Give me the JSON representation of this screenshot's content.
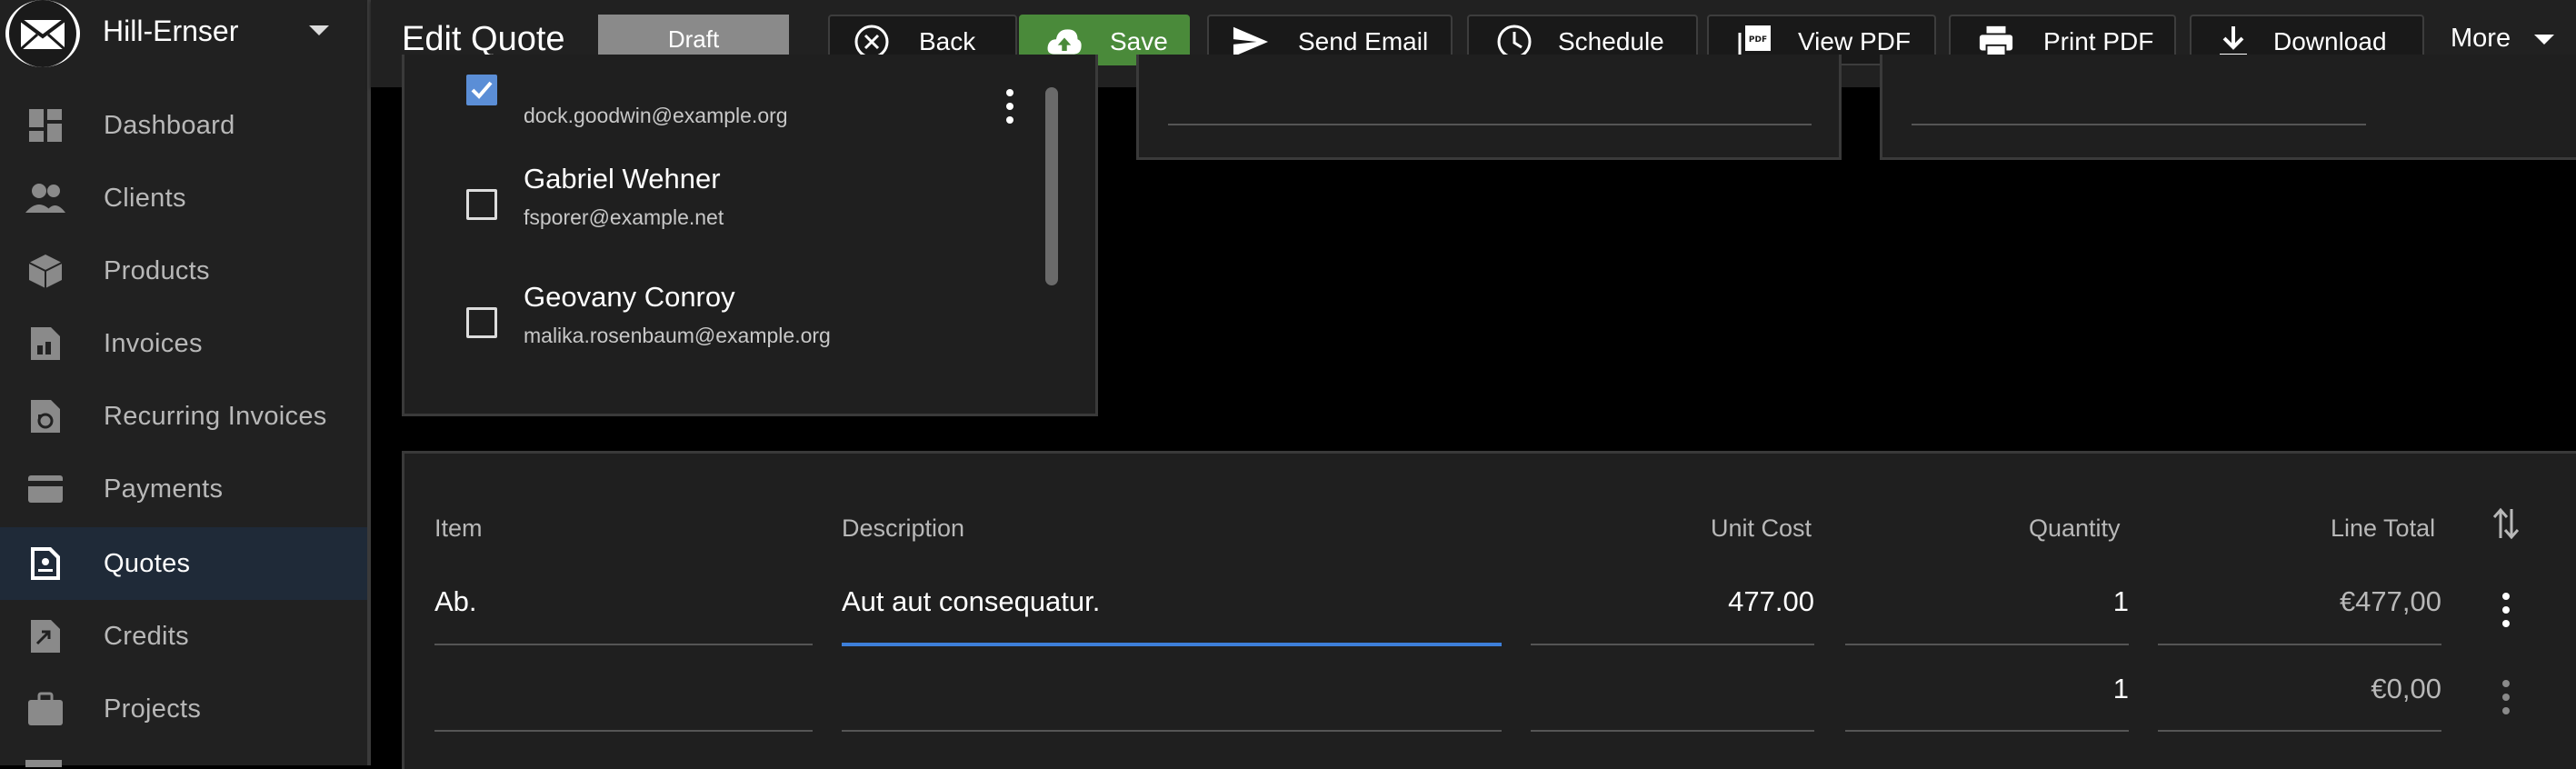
{
  "company": {
    "name": "Hill-Ernser"
  },
  "sidebar": {
    "items": [
      {
        "label": "Dashboard",
        "icon": "dashboard-icon"
      },
      {
        "label": "Clients",
        "icon": "clients-icon"
      },
      {
        "label": "Products",
        "icon": "products-icon"
      },
      {
        "label": "Invoices",
        "icon": "invoices-icon"
      },
      {
        "label": "Recurring Invoices",
        "icon": "recurring-invoices-icon"
      },
      {
        "label": "Payments",
        "icon": "payments-icon"
      },
      {
        "label": "Quotes",
        "icon": "quotes-icon",
        "active": true
      },
      {
        "label": "Credits",
        "icon": "credits-icon"
      },
      {
        "label": "Projects",
        "icon": "projects-icon"
      }
    ]
  },
  "header": {
    "title": "Edit Quote",
    "status": "Draft",
    "buttons": {
      "back": "Back",
      "save": "Save",
      "send_email": "Send Email",
      "schedule": "Schedule",
      "view_pdf": "View PDF",
      "print_pdf": "Print PDF",
      "download": "Download",
      "more": "More"
    }
  },
  "contacts": [
    {
      "name": "",
      "email": "dock.goodwin@example.org",
      "checked": true
    },
    {
      "name": "Gabriel Wehner",
      "email": "fsporer@example.net",
      "checked": false
    },
    {
      "name": "Geovany Conroy",
      "email": "malika.rosenbaum@example.org",
      "checked": false
    }
  ],
  "line_items": {
    "headers": {
      "item": "Item",
      "description": "Description",
      "unit_cost": "Unit Cost",
      "quantity": "Quantity",
      "line_total": "Line Total"
    },
    "rows": [
      {
        "item": "Ab.",
        "description": "Aut aut consequatur.",
        "unit_cost": "477.00",
        "quantity": "1",
        "line_total": "€477,00"
      },
      {
        "item": "",
        "description": "",
        "unit_cost": "",
        "quantity": "1",
        "line_total": "€0,00"
      }
    ]
  },
  "colors": {
    "sidebar_bg": "#212121",
    "active_nav_bg": "#1f2a38",
    "save_green": "#4a8a3a",
    "status_gray": "#8a8a8a",
    "focus_blue": "#3d7fd9",
    "checkbox_blue": "#5b8ed6"
  }
}
